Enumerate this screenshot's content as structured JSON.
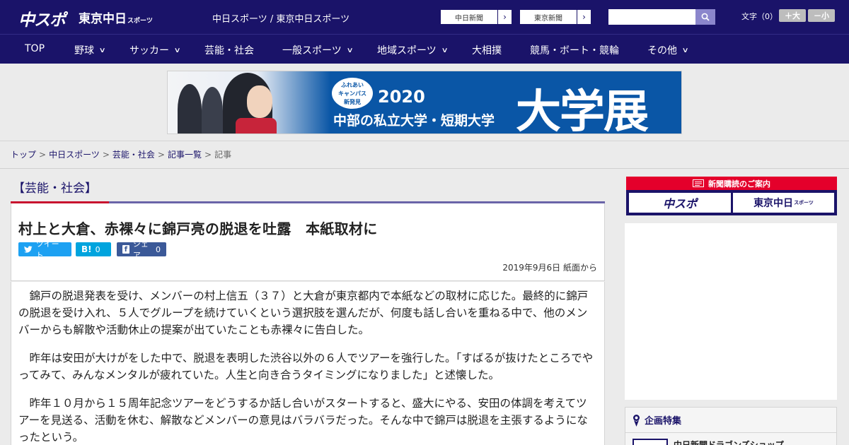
{
  "header": {
    "logo_main": "中スポ",
    "logo_tokyo": "東京中日",
    "logo_tokyo_small": "スポーツ",
    "site_name": "中日スポーツ / 東京中日スポーツ",
    "ext_links": [
      {
        "label": "中日新聞",
        "arrow": "›"
      },
      {
        "label": "東京新聞",
        "arrow": "›"
      }
    ],
    "search_placeholder": "",
    "font_size_label": "文字（0）",
    "font_plus": "＋大",
    "font_minus": "－小"
  },
  "nav": {
    "items": [
      {
        "label": "TOP",
        "has_dropdown": false
      },
      {
        "label": "野球",
        "has_dropdown": true
      },
      {
        "label": "サッカー",
        "has_dropdown": true
      },
      {
        "label": "芸能・社会",
        "has_dropdown": false
      },
      {
        "label": "一般スポーツ",
        "has_dropdown": true
      },
      {
        "label": "地域スポーツ",
        "has_dropdown": true
      },
      {
        "label": "大相撲",
        "has_dropdown": false
      },
      {
        "label": "競馬・ボート・競輪",
        "has_dropdown": false
      },
      {
        "label": "その他",
        "has_dropdown": true
      }
    ],
    "chevron": "∨"
  },
  "banner": {
    "badge_lines": [
      "ふれあい",
      "キャンパス",
      "新発見"
    ],
    "year": "2020",
    "subtitle": "中部の私立大学・短期大学",
    "big_text": "大学展"
  },
  "breadcrumb": {
    "items": [
      "トップ",
      "中日スポーツ",
      "芸能・社会",
      "記事一覧",
      "記事"
    ],
    "separator": ">"
  },
  "article": {
    "category": "【芸能・社会】",
    "title": "村上と大倉、赤裸々に錦戸亮の脱退を吐露　本紙取材に",
    "share": {
      "tweet": "ツイート",
      "hatena_icon": "B!",
      "hatena_count": "0",
      "facebook_label": "シェア",
      "facebook_count": "0"
    },
    "date": "2019年9月6日 紙面から",
    "paragraphs": [
      "錦戸の脱退発表を受け、メンバーの村上信五（３７）と大倉が東京都内で本紙などの取材に応じた。最終的に錦戸の脱退を受け入れ、５人でグループを続けていくという選択肢を選んだが、何度も話し合いを重ねる中で、他のメンバーからも解散や活動休止の提案が出ていたことも赤裸々に告白した。",
      "昨年は安田が大けがをした中で、脱退を表明した渋谷以外の６人でツアーを強行した。「すばるが抜けたところでやってみて、みんなメンタルが疲れていた。人生と向き合うタイミングになりました」と述懐した。",
      "昨年１０月から１５周年記念ツアーをどうするか話し合いがスタートすると、盛大にやる、安田の体調を考えてツアーを見送る、活動を休む、解散などメンバーの意見はバラバラだった。そんな中で錦戸は脱退を主張するようになったという。"
    ]
  },
  "sidebar": {
    "subscribe_head": "新聞購読のご案内",
    "subscribe_links": [
      "中スポ",
      "東京中日"
    ],
    "subscribe_small": "スポーツ",
    "feature_title": "企画特集",
    "feature_item": "中日新聞ドラゴンズショップ"
  },
  "colors": {
    "brand_navy": "#1a1369",
    "accent_red": "#c8102e",
    "twitter": "#1da1f2",
    "hatena": "#00a4de",
    "facebook": "#3b5998"
  }
}
